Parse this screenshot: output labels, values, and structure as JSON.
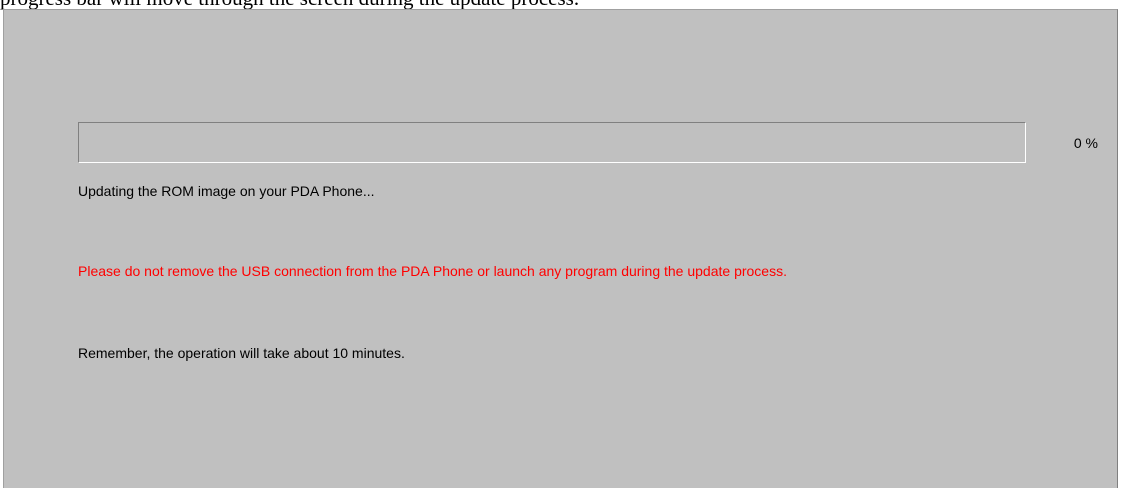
{
  "caption": "progress bar will move through the screen during the update process.",
  "progress": {
    "value_percent": 0,
    "label": "0 %"
  },
  "status": "Updating the ROM image on your PDA Phone...",
  "warning": "Please do not remove the USB connection from the PDA Phone or launch any program during the update process.",
  "reminder": "Remember, the operation will take about 10 minutes.",
  "colors": {
    "panel": "#c0c0c0",
    "warning": "#ff0000",
    "text": "#000000"
  }
}
